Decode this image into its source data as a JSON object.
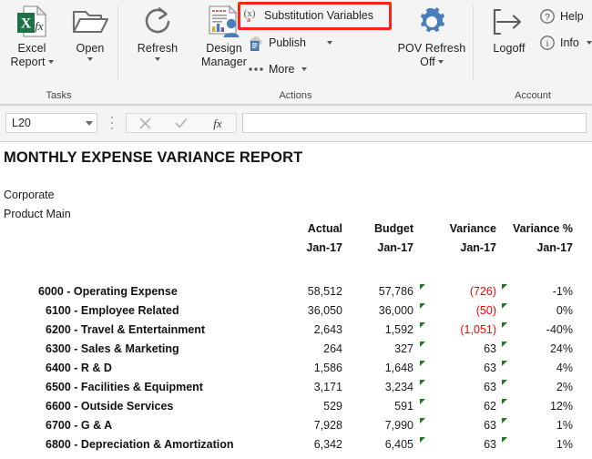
{
  "ribbon": {
    "groups": [
      {
        "label": "Tasks"
      },
      {
        "label": "Actions"
      },
      {
        "label": "Account"
      }
    ],
    "tasks": {
      "excel_report": {
        "label_line1": "Excel",
        "label_line2": "Report",
        "icon": "excel-report-icon",
        "has_dropdown": true
      },
      "open": {
        "label": "Open",
        "icon": "open-folder-icon",
        "has_dropdown": true
      }
    },
    "actions": {
      "refresh": {
        "label": "Refresh",
        "icon": "refresh-circular-arrow-icon",
        "has_dropdown": true
      },
      "design_manager": {
        "label_line1": "Design",
        "label_line2": "Manager",
        "icon": "design-manager-icon",
        "has_dropdown": false
      },
      "substitution_variables": {
        "label": "Substitution Variables",
        "icon": "substitution-variables-icon",
        "icon_text": "(x)",
        "icon_sub": "a",
        "highlighted": true
      },
      "publish": {
        "label": "Publish",
        "icon": "publish-cloud-icon",
        "has_dropdown": true
      },
      "more": {
        "label": "More",
        "icon": "more-ellipsis-icon",
        "has_dropdown": true
      },
      "pov_refresh": {
        "label_line1": "POV Refresh",
        "label_line2": "Off",
        "icon": "pov-refresh-gear-icon",
        "has_dropdown": true
      }
    },
    "account": {
      "logoff": {
        "label": "Logoff",
        "icon": "logoff-arrow-icon"
      },
      "help": {
        "label": "Help",
        "icon": "help-question-icon"
      },
      "info": {
        "label": "Info",
        "icon": "info-circle-icon",
        "has_dropdown": true
      }
    }
  },
  "formula_bar": {
    "name_box_value": "L20",
    "formula_value": "",
    "cancel_icon": "cancel-x-icon",
    "enter_icon": "enter-check-icon",
    "function_icon": "insert-function-fx-icon"
  },
  "report": {
    "title": "MONTHLY EXPENSE VARIANCE REPORT",
    "pov_line1": "Corporate",
    "pov_line2": "Product Main",
    "columns": [
      {
        "name": "Actual",
        "period": "Jan-17"
      },
      {
        "name": "Budget",
        "period": "Jan-17"
      },
      {
        "name": "Variance",
        "period": "Jan-17"
      },
      {
        "name": "Variance %",
        "period": "Jan-17"
      }
    ],
    "rows": [
      {
        "label": "6000 - Operating Expense",
        "indent": 0,
        "actual": "58,512",
        "budget": "57,786",
        "variance": "(726)",
        "variance_negative": true,
        "variance_pct": "-1%"
      },
      {
        "label": "6100 - Employee Related",
        "indent": 1,
        "actual": "36,050",
        "budget": "36,000",
        "variance": "(50)",
        "variance_negative": true,
        "variance_pct": "0%"
      },
      {
        "label": "6200 - Travel & Entertainment",
        "indent": 1,
        "actual": "2,643",
        "budget": "1,592",
        "variance": "(1,051)",
        "variance_negative": true,
        "variance_pct": "-40%"
      },
      {
        "label": "6300 - Sales & Marketing",
        "indent": 1,
        "actual": "264",
        "budget": "327",
        "variance": "63",
        "variance_negative": false,
        "variance_pct": "24%"
      },
      {
        "label": "6400 - R & D",
        "indent": 1,
        "actual": "1,586",
        "budget": "1,648",
        "variance": "63",
        "variance_negative": false,
        "variance_pct": "4%"
      },
      {
        "label": "6500 - Facilities & Equipment",
        "indent": 1,
        "actual": "3,171",
        "budget": "3,234",
        "variance": "63",
        "variance_negative": false,
        "variance_pct": "2%"
      },
      {
        "label": "6600 - Outside Services",
        "indent": 1,
        "actual": "529",
        "budget": "591",
        "variance": "62",
        "variance_negative": false,
        "variance_pct": "12%"
      },
      {
        "label": "6700 - G & A",
        "indent": 1,
        "actual": "7,928",
        "budget": "7,990",
        "variance": "63",
        "variance_negative": false,
        "variance_pct": "1%"
      },
      {
        "label": "6800 - Depreciation & Amortization",
        "indent": 1,
        "actual": "6,342",
        "budget": "6,405",
        "variance": "63",
        "variance_negative": false,
        "variance_pct": "1%"
      }
    ]
  },
  "colors": {
    "highlight": "#ff2418",
    "negative": "#ff0000",
    "comment_marker": "#1e7a1e",
    "excel_green": "#1e7145",
    "accent_blue": "#4a7ebb"
  }
}
